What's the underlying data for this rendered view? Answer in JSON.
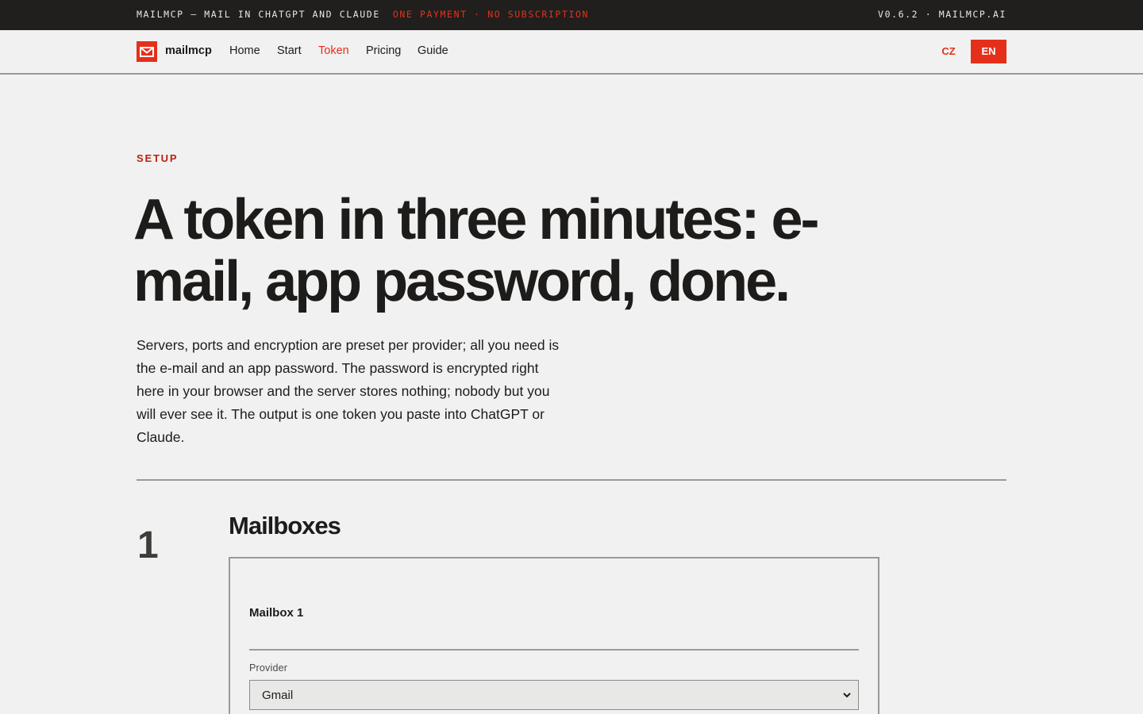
{
  "topbar": {
    "left_text": "MAILMCP — MAIL IN CHATGPT AND CLAUDE",
    "tagline": "ONE PAYMENT · NO SUBSCRIPTION",
    "right_text": "V0.6.2 · MAILMCP.AI"
  },
  "nav": {
    "brand": "mailmcp",
    "logo_icon": "envelope-icon",
    "links": [
      {
        "label": "Home",
        "active": false
      },
      {
        "label": "Start",
        "active": false
      },
      {
        "label": "Token",
        "active": true
      },
      {
        "label": "Pricing",
        "active": false
      },
      {
        "label": "Guide",
        "active": false
      }
    ],
    "languages": [
      {
        "label": "CZ",
        "selected": false
      },
      {
        "label": "EN",
        "selected": true
      }
    ]
  },
  "hero": {
    "eyebrow": "SETUP",
    "title": "A token in three minutes: e-mail, app password, done.",
    "lead": "Servers, ports and encryption are preset per provider; all you need is the e-mail and an app password. The password is encrypted right here in your browser and the server stores nothing; nobody but you will ever see it. The output is one token you paste into ChatGPT or Claude."
  },
  "step": {
    "number": "1",
    "title": "Mailboxes",
    "mailbox_label": "Mailbox 1",
    "provider_label": "Provider",
    "provider_value": "Gmail"
  },
  "colors": {
    "accent": "#e4301b",
    "dark": "#201f1d",
    "background": "#f1f1f1",
    "text": "#1d1c1a"
  }
}
